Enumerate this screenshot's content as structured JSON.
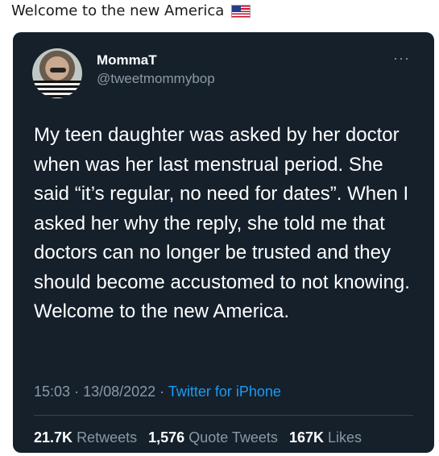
{
  "caption": "Welcome to the new America",
  "tweet": {
    "author_name": "MommaT",
    "author_handle": "@tweetmommybop",
    "more_label": "···",
    "body": "My teen daughter was asked by her doctor when was her last menstrual period. She said “it’s regular, no need for dates”. When I asked her why the reply, she told me that doctors can no longer be trusted and they should become accustomed to not knowing. Welcome to the new America.",
    "time": "15:03",
    "date": "13/08/2022",
    "source": "Twitter for iPhone",
    "separator": "·",
    "stats": {
      "retweets_count": "21.7K",
      "retweets_label": "Retweets",
      "quotes_count": "1,576",
      "quotes_label": "Quote Tweets",
      "likes_count": "167K",
      "likes_label": "Likes"
    }
  },
  "colors": {
    "card_bg": "#15202b",
    "secondary_text": "#8b98a5",
    "link": "#1d9bf0"
  },
  "icons": [
    "us-flag-icon",
    "more-options-icon"
  ]
}
